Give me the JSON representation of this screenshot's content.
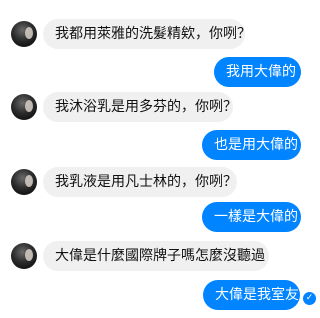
{
  "messages": [
    {
      "from": "other",
      "text": "我都用萊雅的洗髮精欸，你咧？"
    },
    {
      "from": "me",
      "text": "我用大偉的"
    },
    {
      "from": "other",
      "text": "我沐浴乳是用多芬的，你咧？"
    },
    {
      "from": "me",
      "text": "也是用大偉的"
    },
    {
      "from": "other",
      "text": "我乳液是用凡士林的，你咧？"
    },
    {
      "from": "me",
      "text": "一樣是大偉的"
    },
    {
      "from": "other",
      "text": "大偉是什麼國際牌子嗎怎麼沒聽過"
    },
    {
      "from": "me",
      "text": "大偉是我室友"
    }
  ],
  "seen_icon": "check-icon",
  "colors": {
    "outgoing_bubble": "#0084ff",
    "incoming_bubble": "#f1f0f0",
    "outgoing_text": "#ffffff",
    "incoming_text": "#111111"
  }
}
